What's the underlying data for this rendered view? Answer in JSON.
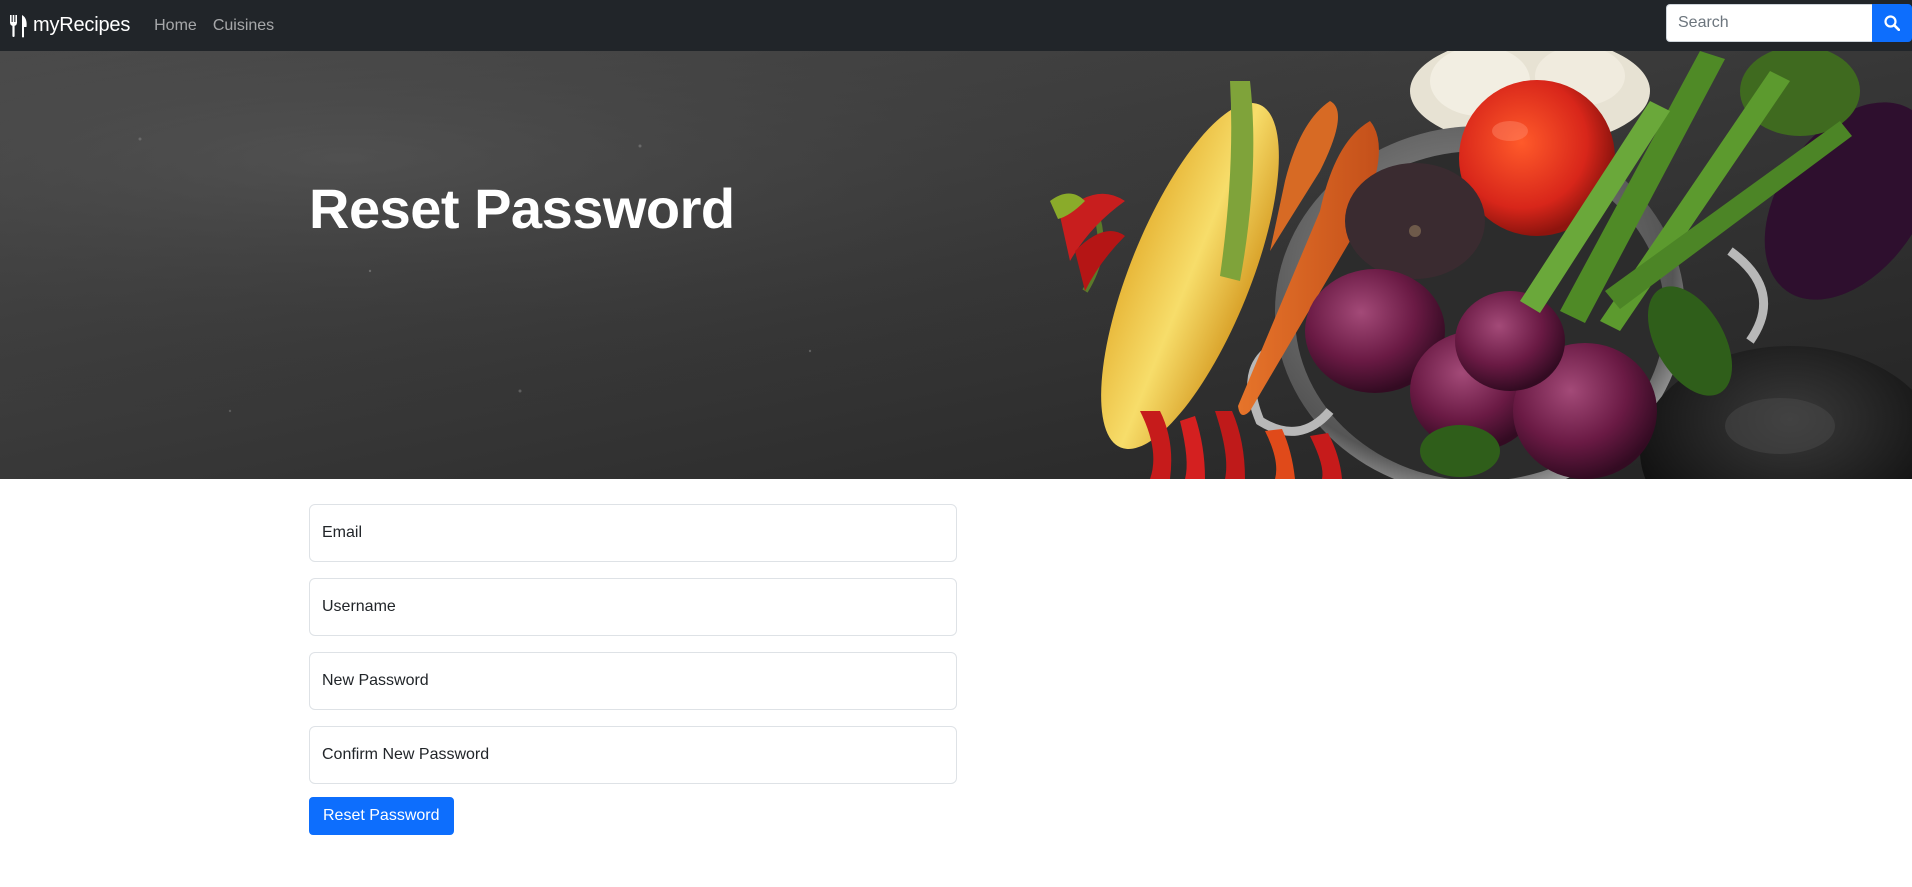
{
  "navbar": {
    "brand_label": "myRecipes",
    "brand_icon": "utensils-icon",
    "links": [
      {
        "label": "Home"
      },
      {
        "label": "Cuisines"
      }
    ],
    "search": {
      "placeholder": "Search",
      "button_icon": "search-icon"
    },
    "background_color": "#212529"
  },
  "hero": {
    "title": "Reset Password",
    "image_description": "vegetables"
  },
  "form": {
    "fields": [
      {
        "placeholder": "Email"
      },
      {
        "placeholder": "Username"
      },
      {
        "placeholder": "New Password"
      },
      {
        "placeholder": "Confirm New Password"
      }
    ],
    "submit_label": "Reset Password"
  },
  "colors": {
    "primary": "#0d6efd",
    "navbar": "#212529"
  }
}
